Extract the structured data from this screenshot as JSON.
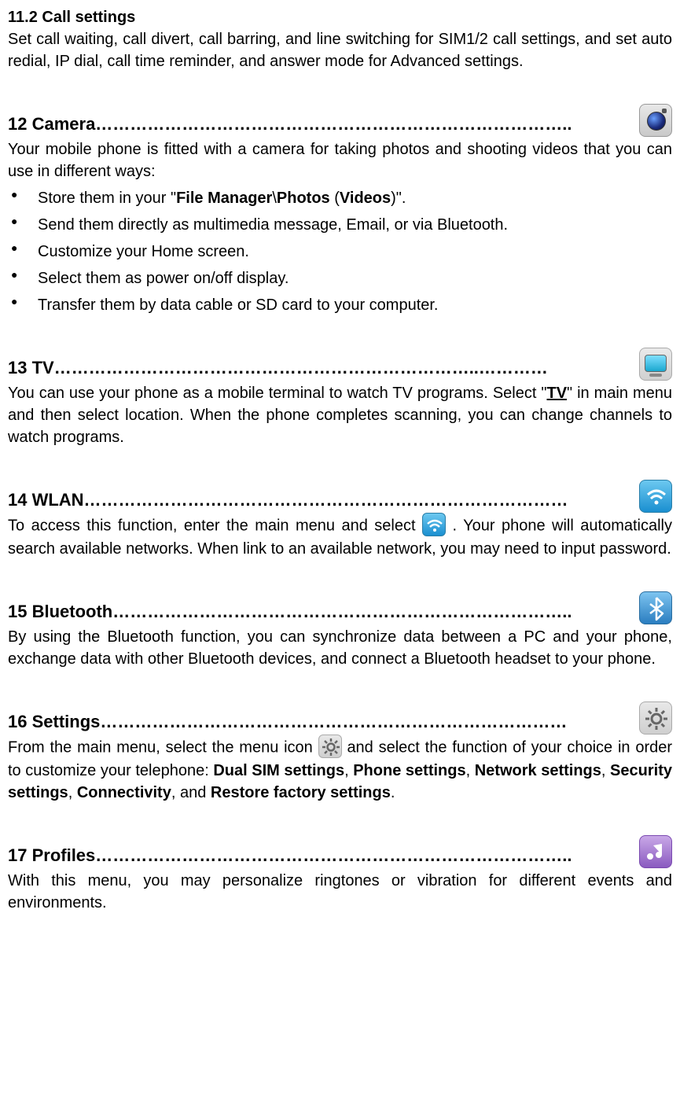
{
  "section_11_2": {
    "heading": "11.2 Call settings",
    "body": "Set call waiting, call divert, call barring, and line switching for SIM1/2 call settings, and set auto redial, IP dial, call time reminder, and answer mode for Advanced settings."
  },
  "section_12": {
    "heading": "12 Camera………………………………………………………………………..",
    "intro": "Your mobile phone is fitted with a camera for taking photos and shooting videos that you can use in different ways:",
    "bullets": {
      "b1_pre": "Store them in your \"",
      "b1_bold1": "File Manager",
      "b1_mid1": "\\",
      "b1_bold2": "Photos",
      "b1_mid2": " (",
      "b1_bold3": "Videos",
      "b1_post": ")\".",
      "b2": "Send them directly as multimedia message, Email, or via Bluetooth.",
      "b3": "Customize your Home screen.",
      "b4": "Select them as power on/off display.",
      "b5": "Transfer them by data cable or SD card to your computer."
    }
  },
  "section_13": {
    "heading": "13 TV………………………………………………………………..…………",
    "body_pre": "You can use your phone as a mobile terminal to watch TV programs. Select \"",
    "body_tv": "TV",
    "body_post": "\" in main menu and then select location. When the phone completes scanning, you can change channels to watch programs."
  },
  "section_14": {
    "heading": "14 WLAN…………………………………………………………………………",
    "body_pre": "To access this function, enter the main menu and select ",
    "body_post": " . Your phone will automatically search available networks. When link to an available network, you may need to input password."
  },
  "section_15": {
    "heading": "15 Bluetooth……………………………………………………………………..",
    "body": "By using the Bluetooth function, you can synchronize data between a PC and your phone, exchange data with other Bluetooth devices, and connect a Bluetooth headset to your phone."
  },
  "section_16": {
    "heading": "16 Settings………………………………………………………………………",
    "body_pre": "From the main menu, select the menu icon   ",
    "body_mid": " and select the function of your choice in order to customize your telephone: ",
    "opt1": "Dual SIM settings",
    "sep1": ", ",
    "opt2": "Phone settings",
    "sep2": ", ",
    "opt3": "Network settings",
    "sep3": ", ",
    "opt4": "Security settings",
    "sep4": ", ",
    "opt5": "Connectivity",
    "sep5": ", and ",
    "opt6": "Restore factory settings",
    "end": "."
  },
  "section_17": {
    "heading": "17 Profiles………………………………………………………………………..",
    "body": "With this menu, you may personalize ringtones or vibration for different events and environments."
  }
}
